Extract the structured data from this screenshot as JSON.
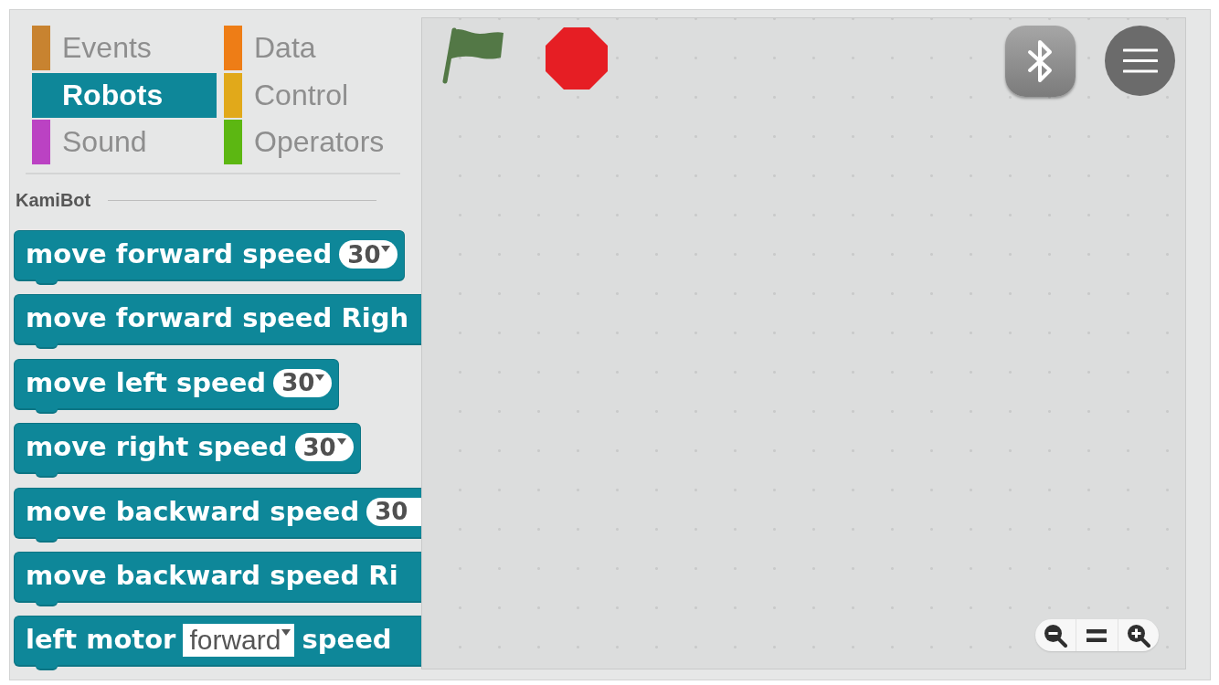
{
  "categories": [
    {
      "label": "Events",
      "color": "#c88330",
      "selected": false
    },
    {
      "label": "Data",
      "color": "#ee7d16",
      "selected": false
    },
    {
      "label": "Robots",
      "color": "#0e8799",
      "selected": true
    },
    {
      "label": "Control",
      "color": "#e1a91a",
      "selected": false
    },
    {
      "label": "Sound",
      "color": "#bb42c3",
      "selected": false
    },
    {
      "label": "Operators",
      "color": "#5cb712",
      "selected": false
    }
  ],
  "palette": {
    "section_title": "KamiBot",
    "blocks": [
      {
        "clipped": false,
        "parts": [
          {
            "kind": "text",
            "text": "move forward speed"
          },
          {
            "kind": "number",
            "value": "30",
            "caret": true
          }
        ]
      },
      {
        "clipped": true,
        "parts": [
          {
            "kind": "text",
            "text": "move forward speed Righ"
          }
        ]
      },
      {
        "clipped": false,
        "parts": [
          {
            "kind": "text",
            "text": "move left speed"
          },
          {
            "kind": "number",
            "value": "30",
            "caret": true
          }
        ]
      },
      {
        "clipped": false,
        "parts": [
          {
            "kind": "text",
            "text": "move right speed"
          },
          {
            "kind": "number",
            "value": "30",
            "caret": true
          }
        ]
      },
      {
        "clipped": true,
        "parts": [
          {
            "kind": "text",
            "text": "move backward speed"
          },
          {
            "kind": "number",
            "value": "30",
            "caret": false
          }
        ]
      },
      {
        "clipped": true,
        "parts": [
          {
            "kind": "text",
            "text": "move backward speed Ri"
          }
        ]
      },
      {
        "clipped": true,
        "parts": [
          {
            "kind": "text",
            "text": "left motor"
          },
          {
            "kind": "menu",
            "value": "forward",
            "caret": true
          },
          {
            "kind": "text",
            "text": "speed"
          }
        ]
      }
    ]
  }
}
